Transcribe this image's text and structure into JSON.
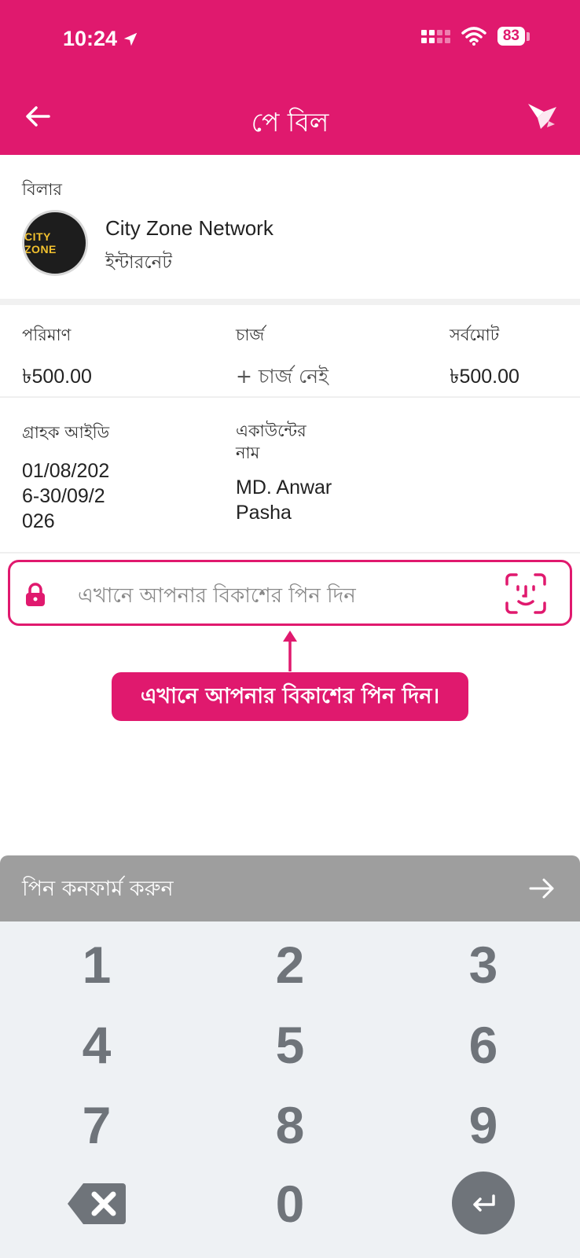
{
  "status_bar": {
    "time": "10:24",
    "battery": "83"
  },
  "header": {
    "title": "পে বিল"
  },
  "biller": {
    "label": "বিলার",
    "logo_text": "CITY ZONE",
    "name": "City Zone Network",
    "type": "ইন্টারনেট"
  },
  "amounts": {
    "amount_label": "পরিমাণ",
    "amount_value": "৳500.00",
    "charge_label": "চার্জ",
    "charge_value": "+ চার্জ নেই",
    "total_label": "সর্বমোট",
    "total_value": "৳500.00"
  },
  "info": {
    "customer_id_label": "গ্রাহক আইডি",
    "customer_id_lines": [
      "01/08/202",
      "6-30/09/2",
      "026"
    ],
    "account_name_label_lines": [
      "একাউন্টের",
      "নাম"
    ],
    "account_name_lines": [
      "MD. Anwar",
      "Pasha"
    ]
  },
  "pin": {
    "placeholder": "এখানে আপনার বিকাশের পিন দিন",
    "hint": "এখানে আপনার বিকাশের পিন দিন।"
  },
  "confirm": {
    "label": "পিন কনফার্ম করুন"
  },
  "keypad": {
    "keys": [
      "1",
      "2",
      "3",
      "4",
      "5",
      "6",
      "7",
      "8",
      "9",
      "0"
    ]
  },
  "colors": {
    "accent": "#e0196e",
    "keypad_bg": "#eef1f4",
    "confirm_bg": "#9e9e9e",
    "key_text": "#6f747a"
  }
}
